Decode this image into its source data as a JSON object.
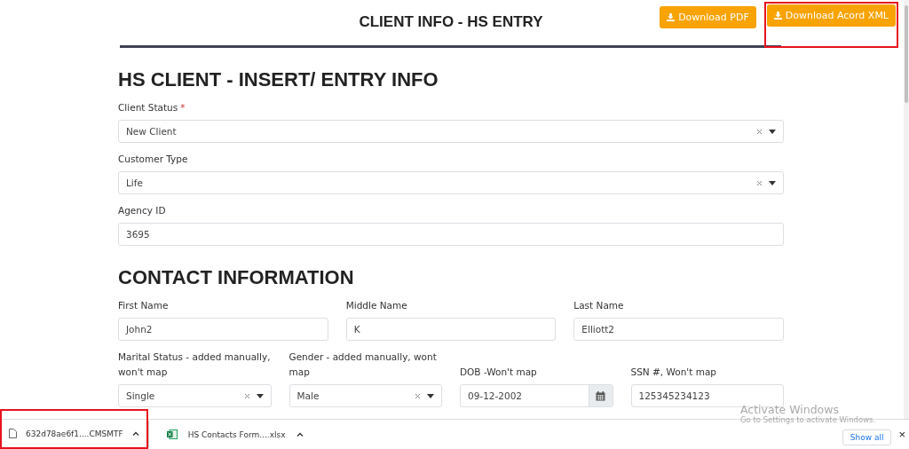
{
  "toolbar": {
    "buttons": [
      {
        "label": "Download PDF",
        "highlighted": false
      },
      {
        "label": "Download Acord XML",
        "highlighted": true
      }
    ]
  },
  "page_title": "CLIENT INFO - HS ENTRY",
  "sections": [
    {
      "heading": "HS CLIENT - INSERT/ ENTRY INFO",
      "rows": [
        [
          {
            "kind": "select",
            "label": "Client Status",
            "required_mark": "*",
            "value": "New Client"
          }
        ],
        [
          {
            "kind": "select",
            "label": "Customer Type",
            "value": "Life"
          }
        ],
        [
          {
            "kind": "text",
            "label": "Agency ID",
            "value": "3695"
          }
        ]
      ]
    },
    {
      "heading": "CONTACT INFORMATION",
      "rows": [
        [
          {
            "kind": "text",
            "label": "First Name",
            "value": "John2"
          },
          {
            "kind": "text",
            "label": "Middle Name",
            "value": "K"
          },
          {
            "kind": "text",
            "label": "Last Name",
            "value": "Elliott2"
          }
        ],
        [
          {
            "kind": "select",
            "label": "Marital Status - added manually, won't map",
            "value": "Single"
          },
          {
            "kind": "select",
            "label": "Gender - added manually, wont map",
            "value": "Male"
          },
          {
            "kind": "date",
            "label": "DOB -Won't map",
            "value": "09-12-2002"
          },
          {
            "kind": "text",
            "label": "SSN #, Won't map",
            "value": "125345234123"
          }
        ]
      ]
    }
  ],
  "windows_notice": {
    "title": "Activate Windows",
    "text": "Go to Settings to activate Windows."
  },
  "download_bar": {
    "items": [
      {
        "kind": "file",
        "name": "632d78ae6f1....CMSMTF",
        "highlighted": true
      },
      {
        "kind": "spreadsheet",
        "name": "HS Contacts Form....xlsx",
        "highlighted": false
      }
    ],
    "show_all": "Show all",
    "close": "×"
  }
}
